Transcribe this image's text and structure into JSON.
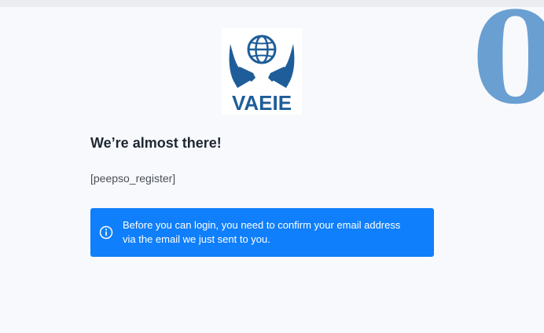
{
  "logo": {
    "text": "VAEIE",
    "icon": "globe-in-hands-icon",
    "colors": {
      "primary": "#1e5d99",
      "background": "#ffffff"
    }
  },
  "corner_digit": "0",
  "heading": "We’re almost there!",
  "shortcode": "[peepso_register]",
  "alert": {
    "icon": "info-circle-icon",
    "line1": "Before you can login, you need to confirm your email address",
    "line2": "via the email we just sent to you.",
    "background": "#0f7ffb"
  }
}
